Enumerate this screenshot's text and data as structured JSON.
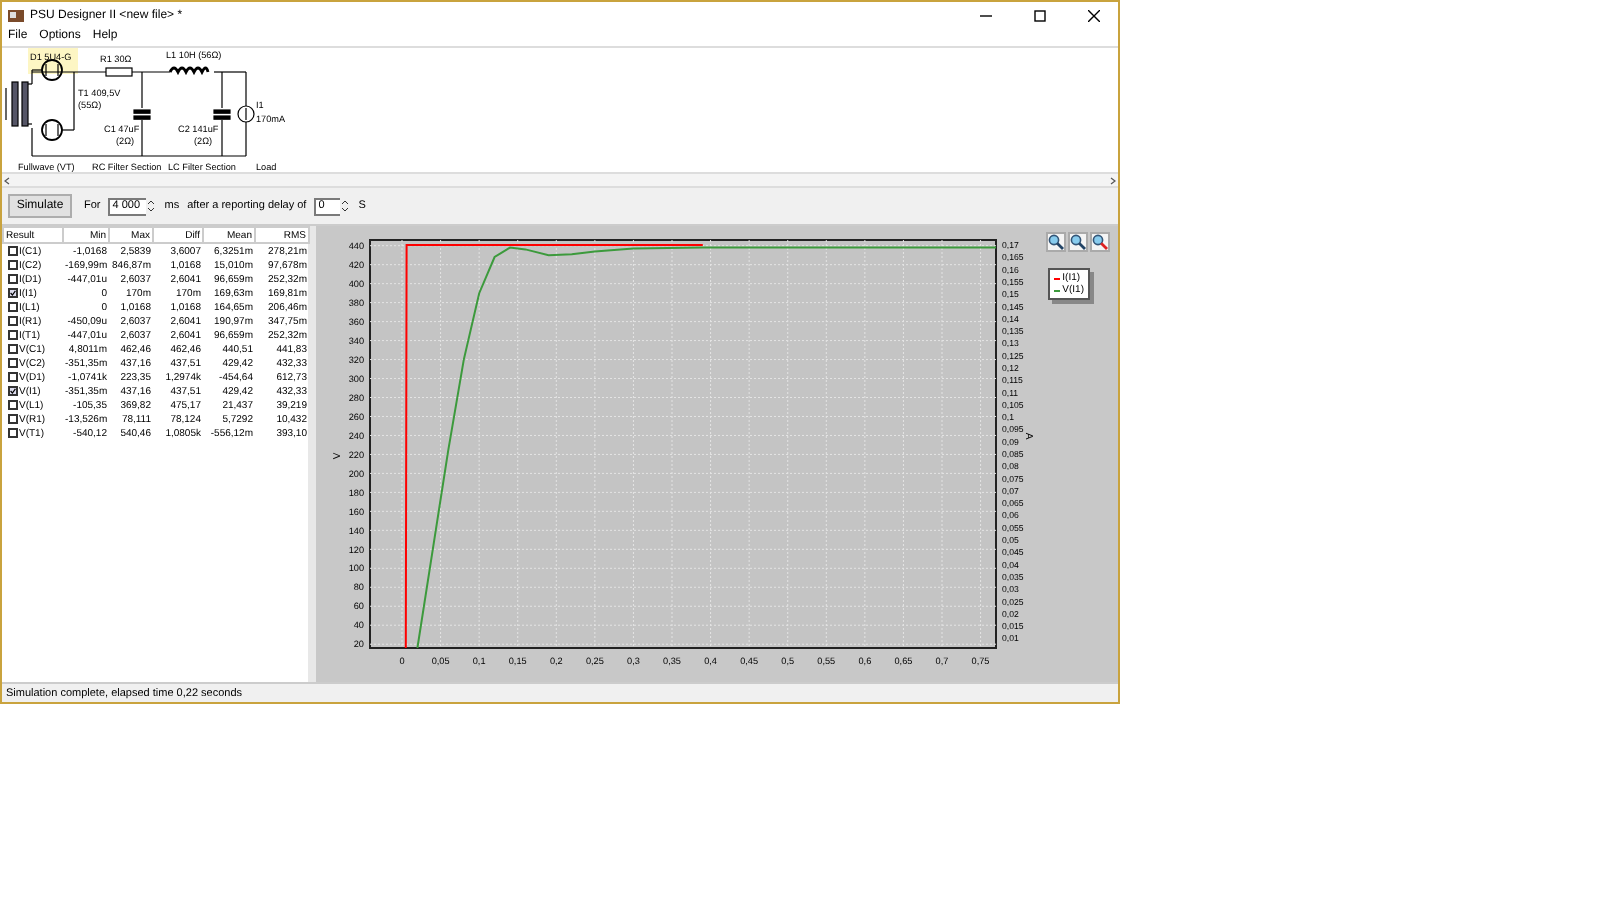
{
  "window": {
    "title": "PSU Designer II  <new file> *"
  },
  "menu": [
    "File",
    "Options",
    "Help"
  ],
  "schematic": {
    "highlighted": true,
    "labels": {
      "d1": "D1 5U4-G",
      "t1": "T1 409,5V",
      "t1r": "(55Ω)",
      "r1": "R1 30Ω",
      "l1": "L1 10H (56Ω)",
      "c1": "C1 47uF",
      "c1r": "(2Ω)",
      "c2": "C2 141uF",
      "c2r": "(2Ω)",
      "i1": "I1",
      "i1v": "170mA"
    },
    "sections": [
      "Fullwave (VT)",
      "RC Filter Section",
      "LC Filter Section",
      "Load"
    ]
  },
  "toolbar": {
    "button": "Simulate",
    "for_label": "For",
    "duration": "4 000",
    "unit": "ms",
    "delay_label": "after a reporting delay of",
    "delay": "0",
    "delay_unit": "S"
  },
  "table": {
    "columns": [
      "Result",
      "Min",
      "Max",
      "Diff",
      "Mean",
      "RMS"
    ],
    "rows": [
      {
        "cells": [
          "I(C1)",
          "-1,0168",
          "2,5839",
          "3,6007",
          "6,3251m",
          "278,21m"
        ],
        "checked": false
      },
      {
        "cells": [
          "I(C2)",
          "-169,99m",
          "846,87m",
          "1,0168",
          "15,010m",
          "97,678m"
        ],
        "checked": false
      },
      {
        "cells": [
          "I(D1)",
          "-447,01u",
          "2,6037",
          "2,6041",
          "96,659m",
          "252,32m"
        ],
        "checked": false
      },
      {
        "cells": [
          "I(I1)",
          "0",
          "170m",
          "170m",
          "169,63m",
          "169,81m"
        ],
        "checked": true
      },
      {
        "cells": [
          "I(L1)",
          "0",
          "1,0168",
          "1,0168",
          "164,65m",
          "206,46m"
        ],
        "checked": false
      },
      {
        "cells": [
          "I(R1)",
          "-450,09u",
          "2,6037",
          "2,6041",
          "190,97m",
          "347,75m"
        ],
        "checked": false
      },
      {
        "cells": [
          "I(T1)",
          "-447,01u",
          "2,6037",
          "2,6041",
          "96,659m",
          "252,32m"
        ],
        "checked": false
      },
      {
        "cells": [
          "V(C1)",
          "4,8011m",
          "462,46",
          "462,46",
          "440,51",
          "441,83"
        ],
        "checked": false
      },
      {
        "cells": [
          "V(C2)",
          "-351,35m",
          "437,16",
          "437,51",
          "429,42",
          "432,33"
        ],
        "checked": false
      },
      {
        "cells": [
          "V(D1)",
          "-1,0741k",
          "223,35",
          "1,2974k",
          "-454,64",
          "612,73"
        ],
        "checked": false
      },
      {
        "cells": [
          "V(I1)",
          "-351,35m",
          "437,16",
          "437,51",
          "429,42",
          "432,33"
        ],
        "checked": true
      },
      {
        "cells": [
          "V(L1)",
          "-105,35",
          "369,82",
          "475,17",
          "21,437",
          "39,219"
        ],
        "checked": false
      },
      {
        "cells": [
          "V(R1)",
          "-13,526m",
          "78,111",
          "78,124",
          "5,7292",
          "10,432"
        ],
        "checked": false
      },
      {
        "cells": [
          "V(T1)",
          "-540,12",
          "540,46",
          "1,0805k",
          "-556,12m",
          "393,10"
        ],
        "checked": false
      }
    ]
  },
  "chart_data": {
    "type": "line",
    "grid": true,
    "ylabel": "V",
    "y2label": "A",
    "xlim": [
      -0.0415,
      0.77
    ],
    "ylim": [
      16,
      446
    ],
    "y2lim": [
      0.006,
      0.172
    ],
    "x": [
      0.005,
      0.006,
      0.02,
      0.04,
      0.06,
      0.08,
      0.1,
      0.12,
      0.14,
      0.16,
      0.19,
      0.22,
      0.25,
      0.3,
      0.39,
      0.5,
      0.6,
      0.7,
      0.77
    ],
    "series": [
      {
        "name": "I(I1)",
        "color": "#ff0000",
        "axis": "y2",
        "values": [
          0.006,
          0.17,
          0.17,
          0.17,
          0.17,
          0.17,
          0.17,
          0.17,
          0.17,
          0.17,
          0.17,
          0.17,
          0.17,
          0.17,
          0.17,
          null,
          null,
          null,
          null
        ]
      },
      {
        "name": "V(I1)",
        "color": "#3c9a3c",
        "values": [
          null,
          null,
          16,
          120,
          224,
          320,
          390,
          428,
          438,
          436,
          430,
          431,
          434,
          437,
          438,
          438,
          438,
          438,
          438
        ]
      }
    ],
    "xticks": [
      {
        "value": 0,
        "label": "0"
      },
      {
        "value": 0.05,
        "label": "0,05"
      },
      {
        "value": 0.1,
        "label": "0,1"
      },
      {
        "value": 0.15,
        "label": "0,15"
      },
      {
        "value": 0.2,
        "label": "0,2"
      },
      {
        "value": 0.25,
        "label": "0,25"
      },
      {
        "value": 0.3,
        "label": "0,3"
      },
      {
        "value": 0.35,
        "label": "0,35"
      },
      {
        "value": 0.4,
        "label": "0,4"
      },
      {
        "value": 0.45,
        "label": "0,45"
      },
      {
        "value": 0.5,
        "label": "0,5"
      },
      {
        "value": 0.55,
        "label": "0,55"
      },
      {
        "value": 0.6,
        "label": "0,6"
      },
      {
        "value": 0.65,
        "label": "0,65"
      },
      {
        "value": 0.7,
        "label": "0,7"
      },
      {
        "value": 0.75,
        "label": "0,75"
      }
    ],
    "yticks": [
      20,
      40,
      60,
      80,
      100,
      120,
      140,
      160,
      180,
      200,
      220,
      240,
      260,
      280,
      300,
      320,
      340,
      360,
      380,
      400,
      420,
      440
    ],
    "y2ticks": [
      {
        "value": 0.01,
        "label": "0,01"
      },
      {
        "value": 0.015,
        "label": "0,015"
      },
      {
        "value": 0.02,
        "label": "0,02"
      },
      {
        "value": 0.025,
        "label": "0,025"
      },
      {
        "value": 0.03,
        "label": "0,03"
      },
      {
        "value": 0.035,
        "label": "0,035"
      },
      {
        "value": 0.04,
        "label": "0,04"
      },
      {
        "value": 0.045,
        "label": "0,045"
      },
      {
        "value": 0.05,
        "label": "0,05"
      },
      {
        "value": 0.055,
        "label": "0,055"
      },
      {
        "value": 0.06,
        "label": "0,06"
      },
      {
        "value": 0.065,
        "label": "0,065"
      },
      {
        "value": 0.07,
        "label": "0,07"
      },
      {
        "value": 0.075,
        "label": "0,075"
      },
      {
        "value": 0.08,
        "label": "0,08"
      },
      {
        "value": 0.085,
        "label": "0,085"
      },
      {
        "value": 0.09,
        "label": "0,09"
      },
      {
        "value": 0.095,
        "label": "0,095"
      },
      {
        "value": 0.1,
        "label": "0,1"
      },
      {
        "value": 0.105,
        "label": "0,105"
      },
      {
        "value": 0.11,
        "label": "0,11"
      },
      {
        "value": 0.115,
        "label": "0,115"
      },
      {
        "value": 0.12,
        "label": "0,12"
      },
      {
        "value": 0.125,
        "label": "0,125"
      },
      {
        "value": 0.13,
        "label": "0,13"
      },
      {
        "value": 0.135,
        "label": "0,135"
      },
      {
        "value": 0.14,
        "label": "0,14"
      },
      {
        "value": 0.145,
        "label": "0,145"
      },
      {
        "value": 0.15,
        "label": "0,15"
      },
      {
        "value": 0.155,
        "label": "0,155"
      },
      {
        "value": 0.16,
        "label": "0,16"
      },
      {
        "value": 0.165,
        "label": "0,165"
      },
      {
        "value": 0.17,
        "label": "0,17"
      }
    ]
  },
  "status_bar": "Simulation complete, elapsed time 0,22 seconds"
}
